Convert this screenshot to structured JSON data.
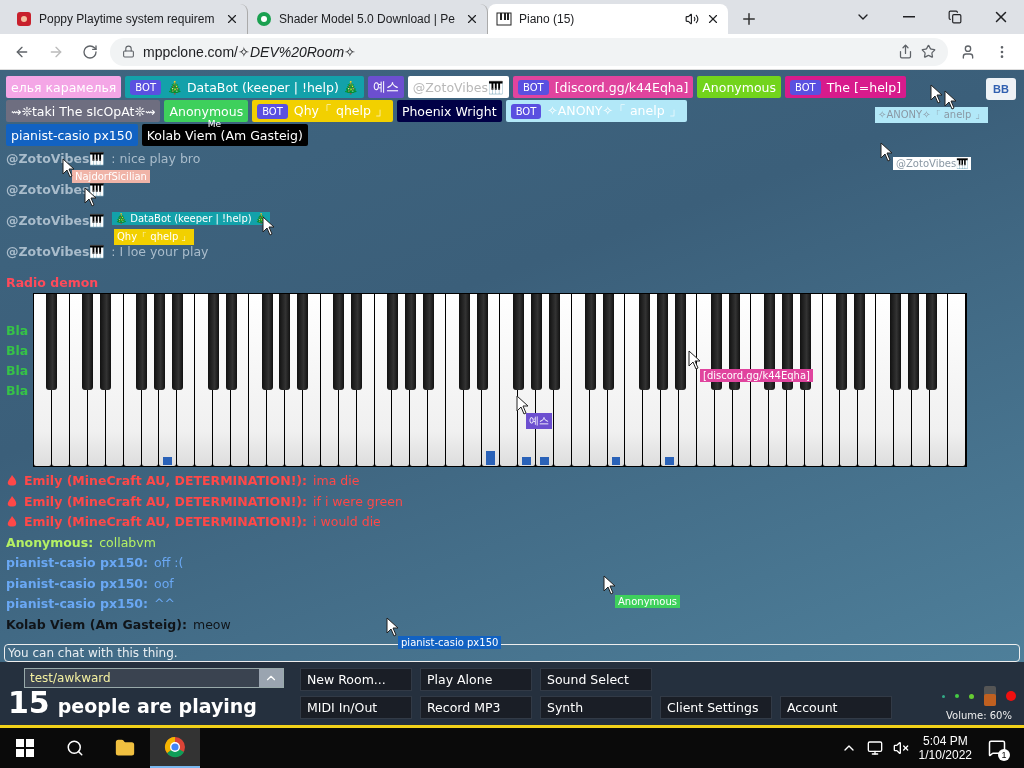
{
  "browser": {
    "tabs": [
      {
        "title": "Poppy Playtime system requirem",
        "kind": "poppy",
        "selected": false
      },
      {
        "title": "Shader Model 5.0 Download | Pe",
        "kind": "shader",
        "selected": false
      },
      {
        "title": "Piano (15)",
        "kind": "piano",
        "selected": true
      }
    ],
    "address": "mppclone.com/✧*DEV%20Room*✧"
  },
  "user_rows": [
    [
      {
        "name": "елья карамелья",
        "color": "#f4a6e6"
      },
      {
        "name": "🎄 DataBot (keeper | !help) 🎄",
        "color": "#13a1aa",
        "badge": "BOT"
      },
      {
        "name": "예스",
        "color": "#6c4fd0"
      },
      {
        "name": "@ZotoVibes🎹",
        "color": "#ffffff"
      },
      {
        "name": "[discord.gg/k44Eqha]",
        "color": "#e0449e",
        "badge": "BOT"
      },
      {
        "name": "Anonymous",
        "color": "#72d41c"
      },
      {
        "name": "The [=help]",
        "color": "#d81b8c",
        "badge": "BOT"
      }
    ],
    [
      {
        "name": "⇝❊taki The sIcOpAt❊⇝",
        "color": "#6e6e80"
      },
      {
        "name": "Anonymous",
        "color": "#3ed05c"
      },
      {
        "name": "Qhy「 qhelp 」",
        "color": "#f2d000",
        "badge": "BOT"
      },
      {
        "name": "Phoenix Wright",
        "color": "#000046"
      },
      {
        "name": "✧ANONY✧「 anelp 」",
        "color": "#b2e8f8",
        "badge": "BOT"
      }
    ],
    [
      {
        "name": "pianist-casio px150",
        "color": "#1262c2"
      },
      {
        "name": "Kolab Viem (Am Gasteig)",
        "color": "#000000",
        "note": "Me"
      }
    ]
  ],
  "bb_button": "BB",
  "chat_top": [
    {
      "name": "@ZotoVibes🎹",
      "text": ": nice play bro",
      "color": "#a9bccb"
    },
    {
      "name": "@ZotoVibes🎹",
      "color": "#a9bccb"
    },
    {
      "name": "@ZotoVibes🎹",
      "color": "#a9bccb"
    },
    {
      "name": "@ZotoVibes🎹",
      "text": ": I loe your play",
      "color": "#a9bccb"
    },
    {
      "name": "Radio demon",
      "color": "#ff4a5a"
    }
  ],
  "chat_side": [
    {
      "name": "Bla",
      "color": "#36c248"
    },
    {
      "name": "Bla",
      "color": "#36c248"
    },
    {
      "name": "Bla",
      "color": "#36c248"
    },
    {
      "name": "Bla",
      "color": "#36c248"
    }
  ],
  "chat_bottom": [
    {
      "name": "Emily (MineCraft AU, DETERMINATION!):",
      "text": "ima die",
      "color": "#ff4848",
      "kind": "flame"
    },
    {
      "name": "Emily (MineCraft AU, DETERMINATION!):",
      "text": "if i were green",
      "color": "#ff4848",
      "kind": "flame"
    },
    {
      "name": "Emily (MineCraft AU, DETERMINATION!):",
      "text": "i would die",
      "color": "#ff4848",
      "kind": "flame"
    },
    {
      "name": "Anonymous:",
      "text": "collabvm",
      "color": "#b4f064",
      "kind": "plain"
    },
    {
      "name": "pianist-casio px150:",
      "text": "off :(",
      "color": "#6aa8f4",
      "kind": "plain"
    },
    {
      "name": "pianist-casio px150:",
      "text": "oof",
      "color": "#6aa8f4",
      "kind": "plain"
    },
    {
      "name": "pianist-casio px150:",
      "text": "^^",
      "color": "#6aa8f4",
      "kind": "plain"
    },
    {
      "name": "Kolab Viem (Am Gasteig):",
      "text": "meow",
      "color": "#101418",
      "kind": "plain"
    }
  ],
  "floating_labels": [
    {
      "text": "✧ANONY✧「 anelp 」",
      "color": "#b2e8f8"
    },
    {
      "text": "@ZotoVibes🎹",
      "color": "#ffffff"
    },
    {
      "text": "NajdorfSicilian",
      "color": "#f0b4a8"
    },
    {
      "text": "🎄 DataBot (keeper | !help) 🎄",
      "color": "#13a1aa"
    },
    {
      "text": "Qhy「 qhelp 」",
      "color": "#f2d000"
    },
    {
      "text": "[discord.gg/k44Eqha]",
      "color": "#e0449e"
    },
    {
      "text": "예스",
      "color": "#6c4fd0"
    },
    {
      "text": "Anonymous",
      "color": "#3ed05c"
    },
    {
      "text": "pianist-casio px150",
      "color": "#1262c2"
    }
  ],
  "chat_input": {
    "placeholder": "You can chat with this thing."
  },
  "controls": {
    "room": "test/awkward",
    "count": "15",
    "count_label": "people are playing",
    "button_rows": [
      [
        "New Room...",
        "Play Alone",
        "Sound Select"
      ],
      [
        "MIDI In/Out",
        "Record MP3",
        "Synth",
        "Client Settings",
        "Account"
      ]
    ],
    "volume": {
      "label": "Volume: 60%",
      "level": 0.6
    }
  },
  "taskbar": {
    "time": "5:04 PM",
    "date": "1/10/2022",
    "notifications": "1"
  }
}
